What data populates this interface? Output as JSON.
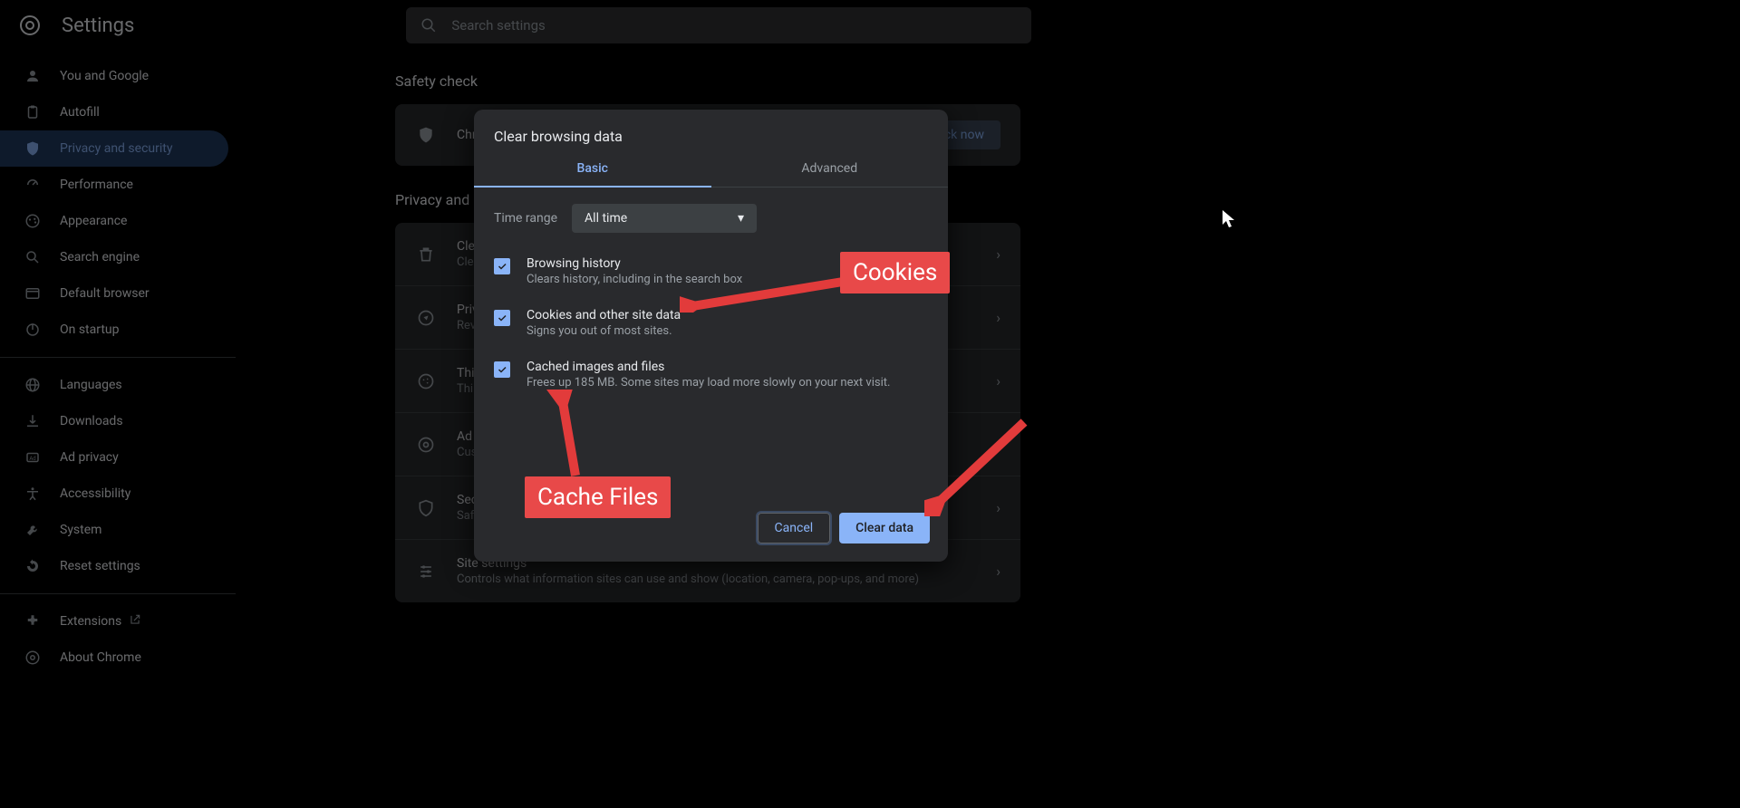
{
  "header": {
    "title": "Settings",
    "search_placeholder": "Search settings"
  },
  "sidebar": {
    "items": [
      {
        "label": "You and Google",
        "icon": "person"
      },
      {
        "label": "Autofill",
        "icon": "clipboard"
      },
      {
        "label": "Privacy and security",
        "icon": "shield",
        "selected": true
      },
      {
        "label": "Performance",
        "icon": "speed"
      },
      {
        "label": "Appearance",
        "icon": "palette"
      },
      {
        "label": "Search engine",
        "icon": "search"
      },
      {
        "label": "Default browser",
        "icon": "browser"
      },
      {
        "label": "On startup",
        "icon": "power"
      }
    ],
    "items2": [
      {
        "label": "Languages",
        "icon": "globe"
      },
      {
        "label": "Downloads",
        "icon": "download"
      },
      {
        "label": "Ad privacy",
        "icon": "ad"
      },
      {
        "label": "Accessibility",
        "icon": "access"
      },
      {
        "label": "System",
        "icon": "wrench"
      },
      {
        "label": "Reset settings",
        "icon": "reset"
      }
    ],
    "items3": [
      {
        "label": "Extensions",
        "icon": "puzzle",
        "external": true
      },
      {
        "label": "About Chrome",
        "icon": "chrome"
      }
    ]
  },
  "main": {
    "safety_heading": "Safety check",
    "safety_row": "Chrome can help keep you safe",
    "check_now": "Check now",
    "priv_heading": "Privacy and security",
    "rows": [
      {
        "title": "Clear browsing data",
        "sub": "Clear history, cookies, cache, and more",
        "icon": "trash"
      },
      {
        "title": "Privacy Guide",
        "sub": "Review key privacy and security controls",
        "icon": "compass"
      },
      {
        "title": "Third-party cookies",
        "sub": "Third-party cookies are blocked",
        "icon": "cookie"
      },
      {
        "title": "Ad privacy",
        "sub": "Customize the info used by sites to show you ads",
        "icon": "ad"
      },
      {
        "title": "Security",
        "sub": "Safe Browsing (protection from dangerous sites) and other security settings",
        "icon": "shield"
      },
      {
        "title": "Site settings",
        "sub": "Controls what information sites can use and show (location, camera, pop-ups, and more)",
        "icon": "sliders"
      }
    ]
  },
  "modal": {
    "title": "Clear browsing data",
    "tabs": {
      "basic": "Basic",
      "advanced": "Advanced"
    },
    "time_label": "Time range",
    "time_value": "All time",
    "options": [
      {
        "title": "Browsing history",
        "sub": "Clears history, including in the search box",
        "checked": true
      },
      {
        "title": "Cookies and other site data",
        "sub": "Signs you out of most sites.",
        "checked": true
      },
      {
        "title": "Cached images and files",
        "sub": "Frees up 185 MB. Some sites may load more slowly on your next visit.",
        "checked": true
      }
    ],
    "cancel": "Cancel",
    "clear": "Clear data"
  },
  "annotations": {
    "cookies": "Cookies",
    "cache": "Cache Files"
  }
}
